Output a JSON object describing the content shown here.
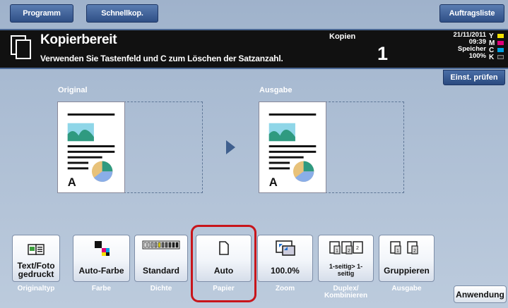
{
  "top_tabs": {
    "programm": "Programm",
    "schnellkop": "Schnellkop.",
    "auftragsliste": "Auftragsliste"
  },
  "status": {
    "title": "Kopierbereit",
    "message": "Verwenden Sie Tastenfeld und C zum Löschen der Satzanzahl.",
    "kopien_label": "Kopien",
    "kopien_value": "1",
    "date": "21/11/2011",
    "time": "09:39",
    "memory_label": "Speicher",
    "memory_value": "100%",
    "toner": [
      {
        "letter": "Y",
        "color": "#f4e200"
      },
      {
        "letter": "M",
        "color": "#e0007a"
      },
      {
        "letter": "C",
        "color": "#00a0e0"
      },
      {
        "letter": "K",
        "color": "#222222"
      }
    ]
  },
  "einst_pruefen": "Einst. prüfen",
  "preview": {
    "original_label": "Original",
    "ausgabe_label": "Ausgabe",
    "doc_letter": "A"
  },
  "functions": [
    {
      "label": "Text/Foto gedruckt",
      "category": "Originaltyp",
      "icon": "text-photo-icon"
    },
    {
      "label": "Auto-Farbe",
      "category": "Farbe",
      "icon": "auto-color-icon"
    },
    {
      "label": "Standard",
      "category": "Dichte",
      "icon": "density-icon"
    },
    {
      "label": "Auto",
      "category": "Papier",
      "icon": "paper-icon"
    },
    {
      "label": "100.0%",
      "category": "Zoom",
      "icon": "zoom-icon"
    },
    {
      "label": "1-seitig> 1-seitig",
      "category": "Duplex/ Kombinieren",
      "icon": "duplex-icon"
    },
    {
      "label": "Gruppieren",
      "category": "Ausgabe",
      "icon": "group-icon"
    }
  ],
  "anwendung": "Anwendung",
  "colors": {
    "accent_tab": "#2f4f86",
    "highlight": "#c8151b",
    "status_bg": "#111111"
  }
}
